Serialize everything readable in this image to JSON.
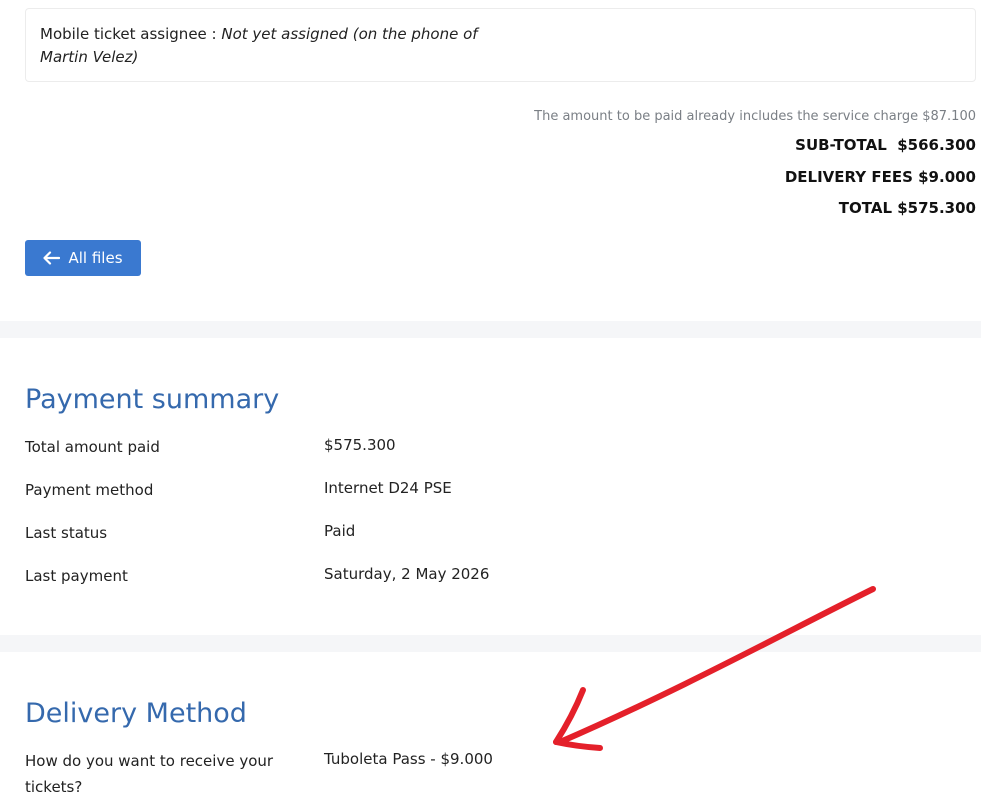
{
  "assignee": {
    "label": "Mobile ticket assignee : ",
    "value": "Not yet assigned (on the phone of Martin Velez)"
  },
  "totals": {
    "note": "The amount to be paid already includes the service charge $87.100",
    "subtotal": "SUB-TOTAL  $566.300",
    "delivery": "DELIVERY FEES $9.000",
    "total": "TOTAL $575.300"
  },
  "back_button": {
    "label": "All files",
    "icon": "arrow-left-icon"
  },
  "payment_summary": {
    "title": "Payment summary",
    "rows": [
      {
        "label": "Total amount paid",
        "value": "$575.300"
      },
      {
        "label": "Payment method",
        "value": "Internet D24 PSE"
      },
      {
        "label": "Last status",
        "value": "Paid"
      },
      {
        "label": "Last payment",
        "value": "Saturday, 2 May 2026"
      }
    ]
  },
  "delivery_method": {
    "title": "Delivery Method",
    "question_line1": "How do you want to receive your",
    "question_line2": "tickets?",
    "answer": "Tuboleta Pass - $9.000"
  },
  "colors": {
    "accent_blue": "#3a79d0",
    "heading_blue": "#3569ad",
    "annotation_red": "#e4202a"
  }
}
